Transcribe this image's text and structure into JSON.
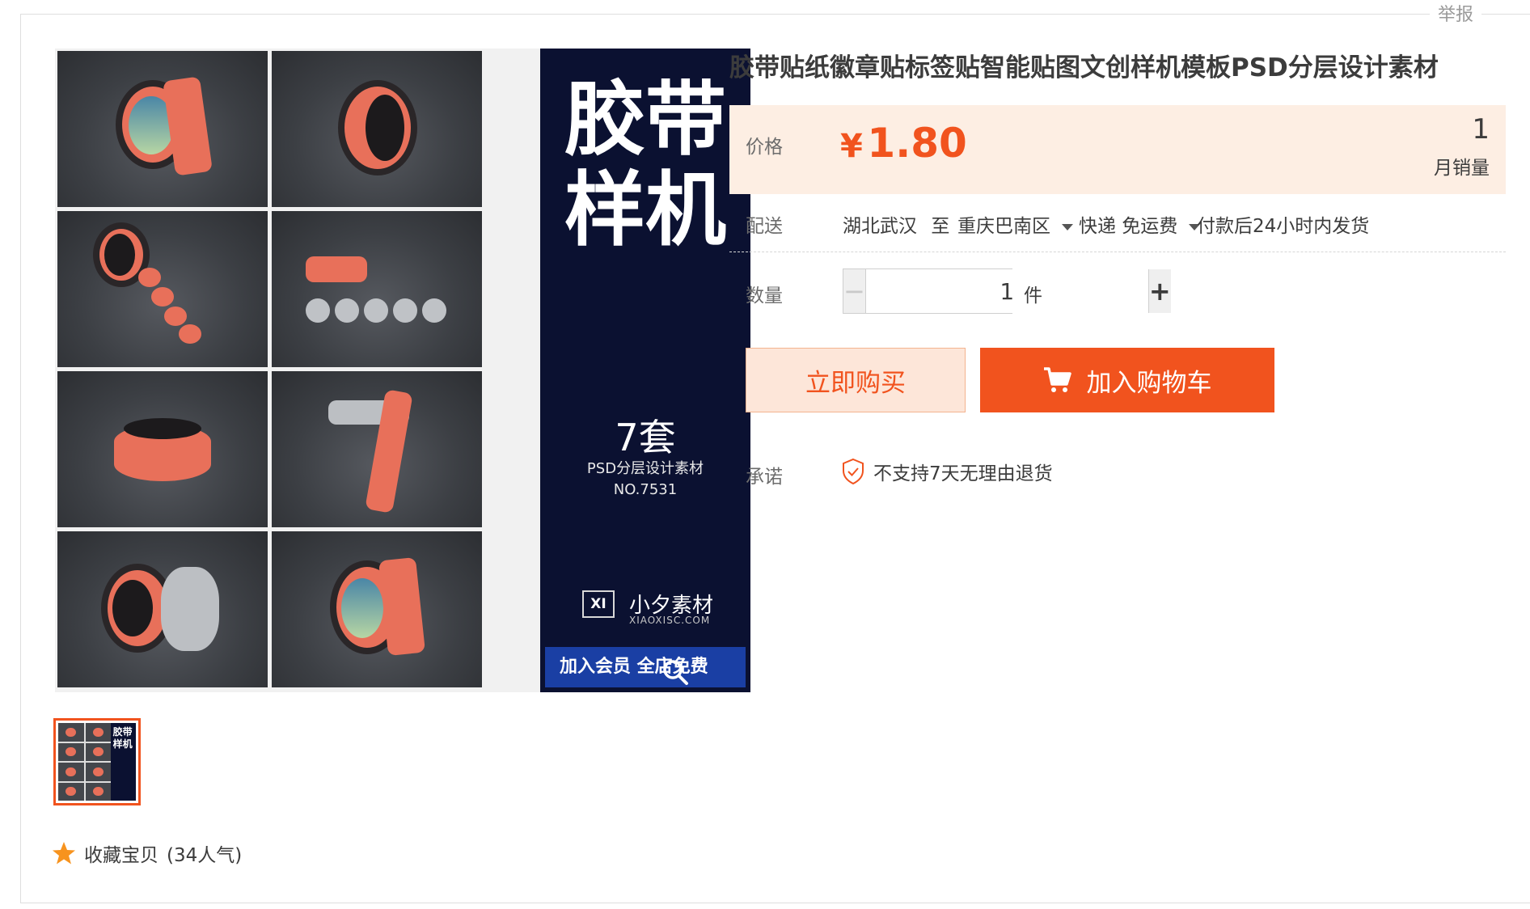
{
  "header": {
    "report_label": "举报"
  },
  "gallery": {
    "promo_title_line1": "胶带",
    "promo_title_line2": "样机",
    "promo_count": "7套",
    "promo_subtitle": "PSD分层设计素材",
    "promo_number": "NO.7531",
    "promo_brand_mark": "XI",
    "promo_brand_name": "小夕素材",
    "promo_brand_url": "XIAOXISC.COM",
    "promo_banner": "加入会员 全店免费",
    "thumb_text": "胶带样机"
  },
  "favorite": {
    "label": "收藏宝贝",
    "popularity": "(34人气)"
  },
  "product": {
    "title": "胶带贴纸徽章贴标签贴智能贴图文创样机模板PSD分层设计素材",
    "price_label": "价格",
    "currency": "¥",
    "price": "1.80",
    "monthly_sales": "1",
    "monthly_sales_label": "月销量"
  },
  "shipping": {
    "label": "配送",
    "from": "湖北武汉",
    "to_word": "至",
    "destination": "重庆巴南区",
    "method": "快递 免运费",
    "dispatch": "付款后24小时内发货"
  },
  "quantity": {
    "label": "数量",
    "value": "1",
    "unit": "件",
    "minus": "−",
    "plus": "+"
  },
  "actions": {
    "buy_now": "立即购买",
    "add_to_cart": "加入购物车"
  },
  "promise": {
    "label": "承诺",
    "text": "不支持7天无理由退货"
  },
  "colors": {
    "accent": "#f1531e",
    "price_bg": "#fdeee3",
    "promo_bg": "#0b1131",
    "banner": "#1a3fa4"
  }
}
